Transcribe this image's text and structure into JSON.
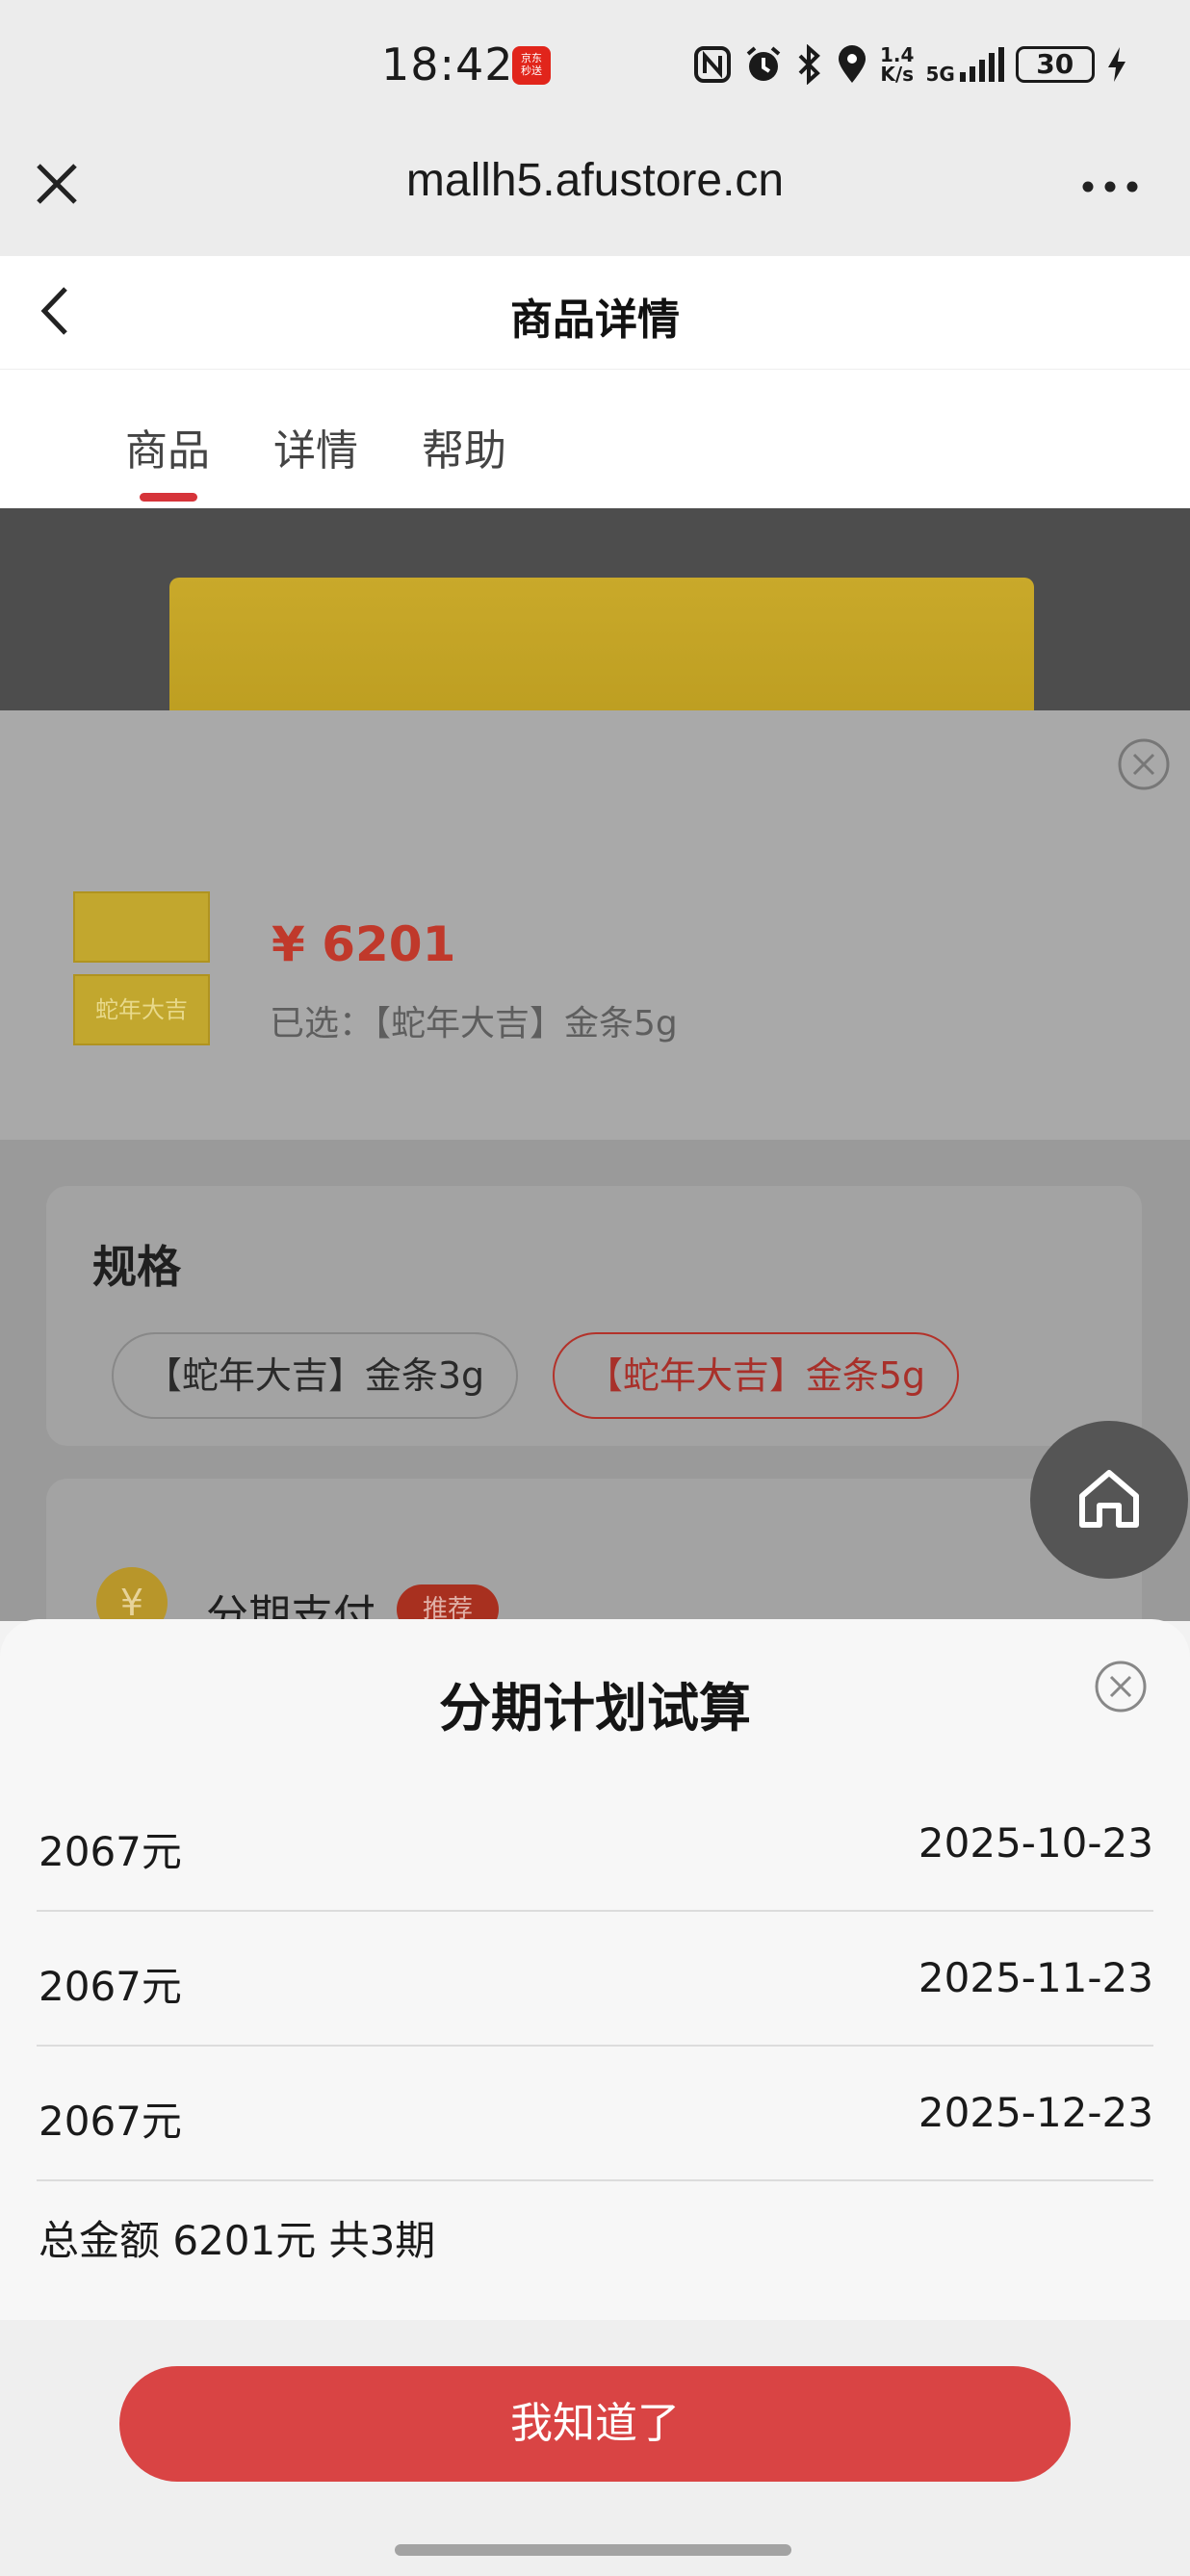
{
  "status_bar": {
    "time": "18:42",
    "jd_badge": "京东\n秒送",
    "net_speed_value": "1.4",
    "net_speed_unit": "K/s",
    "network": "5G",
    "battery": "30"
  },
  "browser": {
    "url": "mallh5.afustore.cn"
  },
  "header": {
    "title": "商品详情"
  },
  "tabs": [
    {
      "label": "商品",
      "active": true
    },
    {
      "label": "详情",
      "active": false
    },
    {
      "label": "帮助",
      "active": false
    }
  ],
  "product": {
    "price": "¥ 6201",
    "selected_text": "已选：【蛇年大吉】金条5g",
    "thumb_text": "蛇年大吉"
  },
  "spec": {
    "title": "规格",
    "options": [
      {
        "label": "【蛇年大吉】金条3g",
        "selected": false
      },
      {
        "label": "【蛇年大吉】金条5g",
        "selected": true
      }
    ]
  },
  "payment": {
    "icon_text": "¥",
    "label": "分期支付",
    "tag": "推荐"
  },
  "installment": {
    "title": "分期计划试算",
    "rows": [
      {
        "amount": "2067元",
        "date": "2025-10-23"
      },
      {
        "amount": "2067元",
        "date": "2025-11-23"
      },
      {
        "amount": "2067元",
        "date": "2025-12-23"
      }
    ],
    "total": "总金额 6201元 共3期",
    "confirm_label": "我知道了"
  },
  "colors": {
    "accent_red": "#d94444",
    "price_red": "#c0392b"
  }
}
